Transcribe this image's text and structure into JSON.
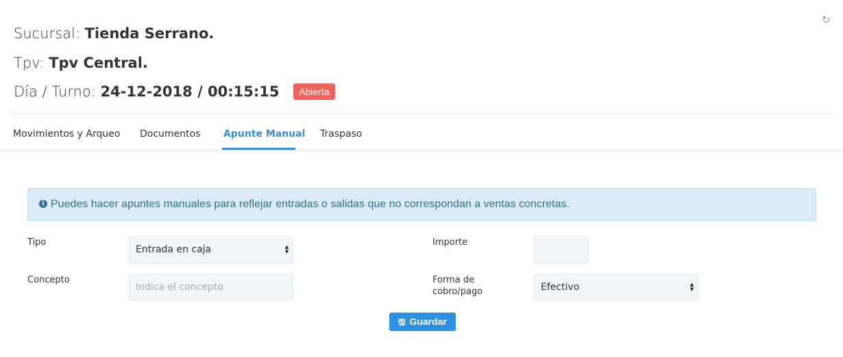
{
  "header": {
    "sucursal_label": "Sucursal:",
    "sucursal_value": "Tienda Serrano.",
    "tpv_label": "Tpv:",
    "tpv_value": "Tpv Central.",
    "turno_label": "Día / Turno:",
    "turno_value": "24-12-2018 / 00:15:15",
    "status_badge": "Abierta",
    "refresh_icon": "refresh-icon"
  },
  "tabs": [
    {
      "label": "Movimientos y Arqueo",
      "active": false
    },
    {
      "label": "Documentos",
      "active": false
    },
    {
      "label": "Apunte Manual",
      "active": true
    },
    {
      "label": "Traspaso",
      "active": false
    }
  ],
  "alert": {
    "icon": "info-circle-icon",
    "text": "Puedes hacer apuntes manuales para reflejar entradas o salidas que no correspondan a ventas concretas."
  },
  "form": {
    "tipo_label": "Tipo",
    "tipo_value": "Entrada en caja",
    "importe_label": "Importe",
    "importe_value": "",
    "concepto_label": "Concepto",
    "concepto_placeholder": "Indica el concepto",
    "forma_label_line1": "Forma de",
    "forma_label_line2": "cobro/pago",
    "forma_value": "Efectivo",
    "save_label": "Guardar",
    "save_icon": "floppy-disk-icon"
  },
  "colors": {
    "accent": "#3a8ed6",
    "badge": "#f0635d",
    "alert_bg": "#d9ecf7",
    "button": "#2d8fe0"
  }
}
